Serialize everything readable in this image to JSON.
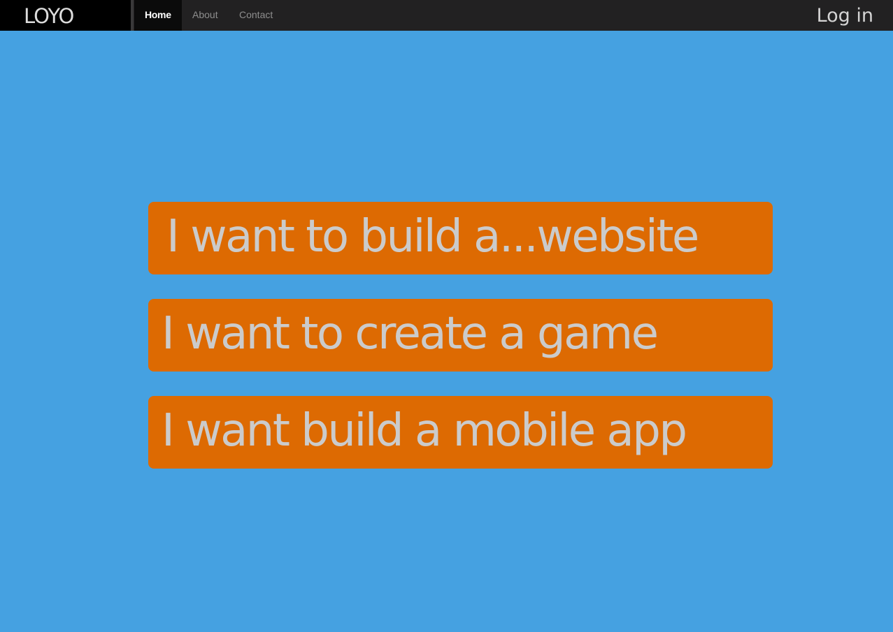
{
  "navbar": {
    "brand": "LOYO",
    "items": [
      {
        "label": "Home",
        "active": true
      },
      {
        "label": "About",
        "active": false
      },
      {
        "label": "Contact",
        "active": false
      }
    ],
    "login_label": "Log in"
  },
  "main": {
    "choices": [
      {
        "label": "I want to build a...website"
      },
      {
        "label": "I want to create a game"
      },
      {
        "label": "I want build a mobile app"
      }
    ]
  },
  "colors": {
    "page_background": "#45a1e1",
    "navbar_background": "#222122",
    "brand_background": "#000000",
    "choice_background": "#dd6a02",
    "choice_text": "#cbcbcb"
  }
}
